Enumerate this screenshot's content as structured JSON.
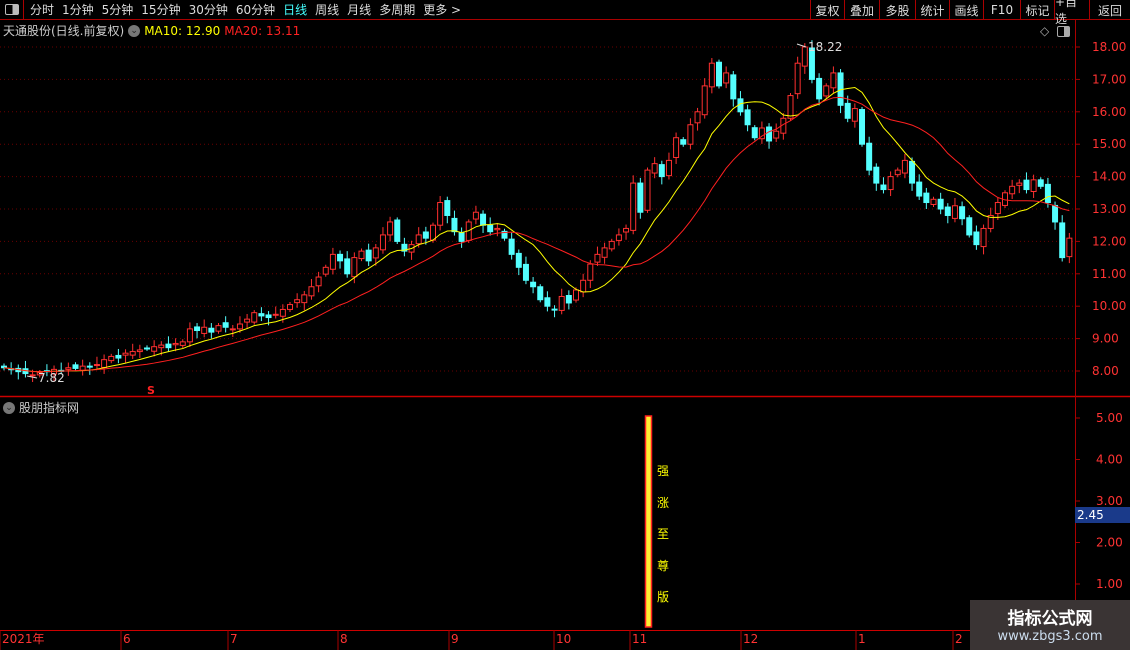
{
  "toolbar": {
    "periods": [
      "分时",
      "1分钟",
      "5分钟",
      "15分钟",
      "30分钟",
      "60分钟",
      "日线",
      "周线",
      "月线",
      "多周期",
      "更多 >"
    ],
    "active": "日线",
    "buttons": [
      "复权",
      "叠加",
      "多股",
      "统计",
      "画线",
      "F10",
      "标记",
      "+自选",
      "返回"
    ]
  },
  "header": {
    "stock": "天通股份(日线.前复权)",
    "ma10": "MA10: 12.90",
    "ma20": "MA20: 13.11"
  },
  "colors": {
    "up": "#ff3030",
    "down": "#54ffff",
    "ma10": "#ffff00",
    "ma20": "#ff2020",
    "axis": "#aa0000"
  },
  "annotations": {
    "high": "18.22",
    "low": "7.82",
    "s_marker": "S"
  },
  "sub_panel": {
    "title": "股朋指标网",
    "vertical_label": [
      "强",
      "涨",
      "至",
      "尊",
      "版"
    ],
    "current_value": "2.45",
    "yticks": [
      "5.00",
      "4.00",
      "3.00",
      "2.00",
      "1.00"
    ]
  },
  "watermark": {
    "name": "指标公式网",
    "url": "www.zbgs3.com"
  },
  "chart_data": {
    "type": "candlestick",
    "ylim": [
      7.5,
      18.5
    ],
    "yticks": [
      "18.00",
      "17.00",
      "16.00",
      "15.00",
      "14.00",
      "13.00",
      "12.00",
      "11.00",
      "10.00",
      "9.00",
      "8.00"
    ],
    "xticks": [
      "2021年",
      "6",
      "7",
      "8",
      "9",
      "10",
      "11",
      "12",
      "1",
      "2"
    ],
    "closes": [
      8.1,
      8.05,
      7.98,
      7.92,
      7.88,
      7.95,
      8.0,
      8.05,
      8.02,
      8.1,
      8.08,
      8.15,
      8.12,
      8.2,
      8.35,
      8.45,
      8.4,
      8.55,
      8.6,
      8.65,
      8.7,
      8.75,
      8.8,
      8.72,
      8.85,
      8.9,
      9.3,
      9.25,
      9.35,
      9.2,
      9.4,
      9.35,
      9.3,
      9.45,
      9.6,
      9.8,
      9.7,
      9.65,
      9.75,
      9.9,
      10.05,
      10.2,
      10.35,
      10.6,
      10.9,
      11.2,
      11.6,
      11.4,
      11.0,
      11.5,
      11.7,
      11.4,
      11.8,
      12.2,
      12.6,
      12.0,
      11.7,
      11.9,
      12.2,
      12.1,
      12.5,
      13.2,
      12.8,
      12.3,
      12.0,
      12.6,
      12.9,
      12.5,
      12.3,
      12.4,
      12.1,
      11.6,
      11.2,
      10.8,
      10.6,
      10.2,
      10.0,
      9.9,
      10.3,
      10.1,
      10.5,
      10.8,
      11.3,
      11.6,
      11.8,
      12.0,
      12.2,
      12.4,
      13.8,
      12.9,
      14.2,
      14.4,
      14.0,
      14.5,
      15.2,
      15.0,
      15.6,
      16.0,
      16.8,
      17.5,
      16.8,
      17.2,
      16.4,
      16.0,
      15.6,
      15.2,
      15.5,
      15.1,
      15.4,
      15.8,
      16.5,
      17.5,
      18.0,
      17.0,
      16.4,
      16.8,
      17.2,
      16.2,
      15.8,
      16.1,
      15.0,
      14.2,
      13.8,
      13.6,
      14.0,
      14.2,
      14.5,
      13.8,
      13.4,
      13.2,
      13.3,
      13.0,
      12.8,
      13.1,
      12.7,
      12.2,
      11.9,
      12.4,
      12.8,
      13.2,
      13.5,
      13.7,
      13.8,
      13.6,
      13.9,
      13.7,
      13.2,
      12.6,
      11.5,
      12.1
    ],
    "series": [
      {
        "name": "MA10",
        "period": 10
      },
      {
        "name": "MA20",
        "period": 20
      }
    ],
    "indicator_bar": {
      "from": 0,
      "to": 5
    }
  }
}
